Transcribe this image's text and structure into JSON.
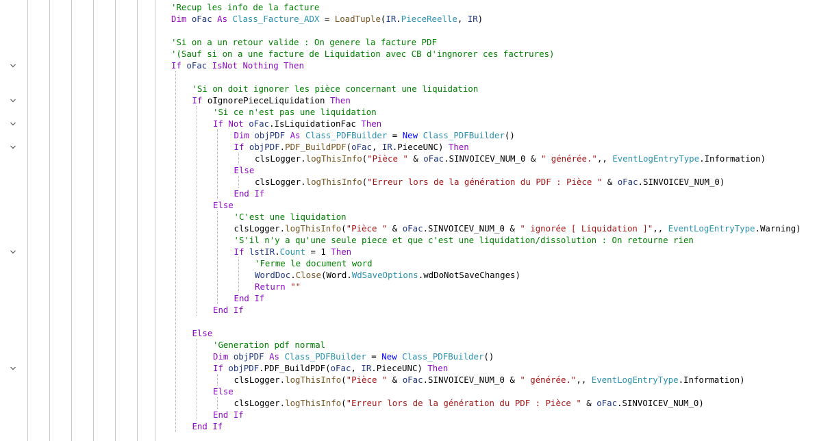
{
  "editor": {
    "language": "VB.NET",
    "colors": {
      "comment": "#008000",
      "keyword": "#8f08c4",
      "keyword_blue": "#0000ff",
      "type": "#2b91af",
      "string": "#a31515",
      "method": "#74531f",
      "variable": "#1f377f",
      "plain": "#000000",
      "indent_guide": "#c8c8c8"
    },
    "fold_icon": "chevron-down-icon",
    "lines": [
      {
        "indent": 0,
        "fold": false,
        "tokens": [
          [
            "c",
            "'Recup les info de la facture"
          ]
        ]
      },
      {
        "indent": 0,
        "fold": false,
        "tokens": [
          [
            "k",
            "Dim "
          ],
          [
            "v",
            "oFac"
          ],
          [
            "p",
            " "
          ],
          [
            "k",
            "As "
          ],
          [
            "t",
            "Class_Facture_ADX"
          ],
          [
            "p",
            " = "
          ],
          [
            "m",
            "LoadTuple"
          ],
          [
            "p",
            "("
          ],
          [
            "v",
            "IR"
          ],
          [
            "p",
            "."
          ],
          [
            "t",
            "PieceReelle"
          ],
          [
            "p",
            ", "
          ],
          [
            "v",
            "IR"
          ],
          [
            "p",
            ")"
          ]
        ]
      },
      {
        "indent": 0,
        "fold": false,
        "tokens": []
      },
      {
        "indent": 0,
        "fold": false,
        "tokens": [
          [
            "c",
            "'Si on a un retour valide : On genere la facture PDF"
          ]
        ]
      },
      {
        "indent": 0,
        "fold": false,
        "tokens": [
          [
            "c",
            "'(Sauf si on a une facture de Liquidation avec CB d'ingnorer ces factrures)"
          ]
        ]
      },
      {
        "indent": 0,
        "fold": true,
        "tokens": [
          [
            "k",
            "If "
          ],
          [
            "v",
            "oFac"
          ],
          [
            "p",
            " "
          ],
          [
            "k",
            "IsNot Nothing Then"
          ]
        ]
      },
      {
        "indent": 1,
        "fold": false,
        "tokens": []
      },
      {
        "indent": 1,
        "fold": false,
        "tokens": [
          [
            "c",
            "'Si on doit ignorer les pièce concernant une liquidation"
          ]
        ]
      },
      {
        "indent": 1,
        "fold": true,
        "tokens": [
          [
            "k",
            "If "
          ],
          [
            "p",
            "oIgnorePieceLiquidation "
          ],
          [
            "k",
            "Then"
          ]
        ]
      },
      {
        "indent": 2,
        "fold": false,
        "tokens": [
          [
            "c",
            "'Si ce n'est pas une liquidation"
          ]
        ]
      },
      {
        "indent": 2,
        "fold": true,
        "tokens": [
          [
            "k",
            "If Not "
          ],
          [
            "v",
            "oFac"
          ],
          [
            "p",
            ".IsLiquidationFac "
          ],
          [
            "k",
            "Then"
          ]
        ]
      },
      {
        "indent": 3,
        "fold": false,
        "tokens": [
          [
            "k",
            "Dim "
          ],
          [
            "v",
            "objPDF"
          ],
          [
            "p",
            " "
          ],
          [
            "k",
            "As "
          ],
          [
            "t",
            "Class_PDFBuilder"
          ],
          [
            "p",
            " = "
          ],
          [
            "kb",
            "New "
          ],
          [
            "t",
            "Class_PDFBuilder"
          ],
          [
            "p",
            "()"
          ]
        ]
      },
      {
        "indent": 3,
        "fold": true,
        "tokens": [
          [
            "k",
            "If "
          ],
          [
            "v",
            "objPDF"
          ],
          [
            "p",
            "."
          ],
          [
            "m",
            "PDF_BuildPDF"
          ],
          [
            "p",
            "("
          ],
          [
            "v",
            "oFac"
          ],
          [
            "p",
            ", "
          ],
          [
            "v",
            "IR"
          ],
          [
            "p",
            ".PieceUNC) "
          ],
          [
            "k",
            "Then"
          ]
        ]
      },
      {
        "indent": 4,
        "fold": false,
        "tokens": [
          [
            "p",
            "clsLogger."
          ],
          [
            "m",
            "logThisInfo"
          ],
          [
            "p",
            "("
          ],
          [
            "s",
            "\"Pièce \""
          ],
          [
            "p",
            " & "
          ],
          [
            "v",
            "oFac"
          ],
          [
            "p",
            ".SINVOICEV_NUM_0 & "
          ],
          [
            "s",
            "\" générée.\""
          ],
          [
            "p",
            ",, "
          ],
          [
            "t",
            "EventLogEntryType"
          ],
          [
            "p",
            ".Information)"
          ]
        ]
      },
      {
        "indent": 3,
        "fold": false,
        "tokens": [
          [
            "k",
            "Else"
          ]
        ]
      },
      {
        "indent": 4,
        "fold": false,
        "tokens": [
          [
            "p",
            "clsLogger."
          ],
          [
            "m",
            "logThisInfo"
          ],
          [
            "p",
            "("
          ],
          [
            "s",
            "\"Erreur lors de la génération du PDF : Pièce \""
          ],
          [
            "p",
            " & "
          ],
          [
            "v",
            "oFac"
          ],
          [
            "p",
            ".SINVOICEV_NUM_0)"
          ]
        ]
      },
      {
        "indent": 3,
        "fold": false,
        "tokens": [
          [
            "k",
            "End If"
          ]
        ]
      },
      {
        "indent": 2,
        "fold": false,
        "tokens": [
          [
            "k",
            "Else"
          ]
        ]
      },
      {
        "indent": 3,
        "fold": false,
        "tokens": [
          [
            "c",
            "'C'est une liquidation"
          ]
        ]
      },
      {
        "indent": 3,
        "fold": false,
        "tokens": [
          [
            "p",
            "clsLogger."
          ],
          [
            "m",
            "logThisInfo"
          ],
          [
            "p",
            "("
          ],
          [
            "s",
            "\"Pièce \""
          ],
          [
            "p",
            " & "
          ],
          [
            "v",
            "oFac"
          ],
          [
            "p",
            ".SINVOICEV_NUM_0 & "
          ],
          [
            "s",
            "\" ignorée [ Liquidation ]\""
          ],
          [
            "p",
            ",, "
          ],
          [
            "t",
            "EventLogEntryType"
          ],
          [
            "p",
            ".Warning)"
          ]
        ]
      },
      {
        "indent": 3,
        "fold": false,
        "tokens": [
          [
            "c",
            "'S'il n'y a qu'une seule piece et que c'est une liquidation/dissolution : On retourne rien"
          ]
        ]
      },
      {
        "indent": 3,
        "fold": true,
        "tokens": [
          [
            "k",
            "If "
          ],
          [
            "v",
            "lstIR"
          ],
          [
            "p",
            "."
          ],
          [
            "t",
            "Count"
          ],
          [
            "p",
            " = 1 "
          ],
          [
            "k",
            "Then"
          ]
        ]
      },
      {
        "indent": 4,
        "fold": false,
        "tokens": [
          [
            "c",
            "'Ferme le document word"
          ]
        ]
      },
      {
        "indent": 4,
        "fold": false,
        "tokens": [
          [
            "v",
            "WordDoc"
          ],
          [
            "p",
            "."
          ],
          [
            "m",
            "Close"
          ],
          [
            "p",
            "(Word."
          ],
          [
            "t",
            "WdSaveOptions"
          ],
          [
            "p",
            ".wdDoNotSaveChanges)"
          ]
        ]
      },
      {
        "indent": 4,
        "fold": false,
        "tokens": [
          [
            "k",
            "Return "
          ],
          [
            "s",
            "\"\""
          ]
        ]
      },
      {
        "indent": 3,
        "fold": false,
        "tokens": [
          [
            "k",
            "End If"
          ]
        ]
      },
      {
        "indent": 2,
        "fold": false,
        "tokens": [
          [
            "k",
            "End If"
          ]
        ]
      },
      {
        "indent": 1,
        "fold": false,
        "tokens": []
      },
      {
        "indent": 1,
        "fold": false,
        "tokens": [
          [
            "k",
            "Else"
          ]
        ]
      },
      {
        "indent": 2,
        "fold": false,
        "tokens": [
          [
            "c",
            "'Generation pdf normal"
          ]
        ]
      },
      {
        "indent": 2,
        "fold": false,
        "tokens": [
          [
            "k",
            "Dim "
          ],
          [
            "v",
            "objPDF"
          ],
          [
            "p",
            " "
          ],
          [
            "k",
            "As "
          ],
          [
            "t",
            "Class_PDFBuilder"
          ],
          [
            "p",
            " = "
          ],
          [
            "kb",
            "New "
          ],
          [
            "t",
            "Class_PDFBuilder"
          ],
          [
            "p",
            "()"
          ]
        ]
      },
      {
        "indent": 2,
        "fold": true,
        "tokens": [
          [
            "k",
            "If "
          ],
          [
            "v",
            "objPDF"
          ],
          [
            "p",
            ".PDF_BuildPDF("
          ],
          [
            "v",
            "oFac"
          ],
          [
            "p",
            ", "
          ],
          [
            "v",
            "IR"
          ],
          [
            "p",
            ".PieceUNC) "
          ],
          [
            "k",
            "Then"
          ]
        ]
      },
      {
        "indent": 3,
        "fold": false,
        "tokens": [
          [
            "p",
            "clsLogger."
          ],
          [
            "m",
            "logThisInfo"
          ],
          [
            "p",
            "("
          ],
          [
            "s",
            "\"Pièce \""
          ],
          [
            "p",
            " & "
          ],
          [
            "v",
            "oFac"
          ],
          [
            "p",
            ".SINVOICEV_NUM_0 & "
          ],
          [
            "s",
            "\" générée.\""
          ],
          [
            "p",
            ",, "
          ],
          [
            "t",
            "EventLogEntryType"
          ],
          [
            "p",
            ".Information)"
          ]
        ]
      },
      {
        "indent": 2,
        "fold": false,
        "tokens": [
          [
            "k",
            "Else"
          ]
        ]
      },
      {
        "indent": 3,
        "fold": false,
        "tokens": [
          [
            "p",
            "clsLogger."
          ],
          [
            "m",
            "logThisInfo"
          ],
          [
            "p",
            "("
          ],
          [
            "s",
            "\"Erreur lors de la génération du PDF : Pièce \""
          ],
          [
            "p",
            " & "
          ],
          [
            "v",
            "oFac"
          ],
          [
            "p",
            ".SINVOICEV_NUM_0)"
          ]
        ]
      },
      {
        "indent": 2,
        "fold": false,
        "tokens": [
          [
            "k",
            "End If"
          ]
        ]
      },
      {
        "indent": 1,
        "fold": false,
        "tokens": [
          [
            "k",
            "End If"
          ]
        ]
      },
      {
        "indent": 0,
        "fold": false,
        "tokens": []
      }
    ]
  }
}
